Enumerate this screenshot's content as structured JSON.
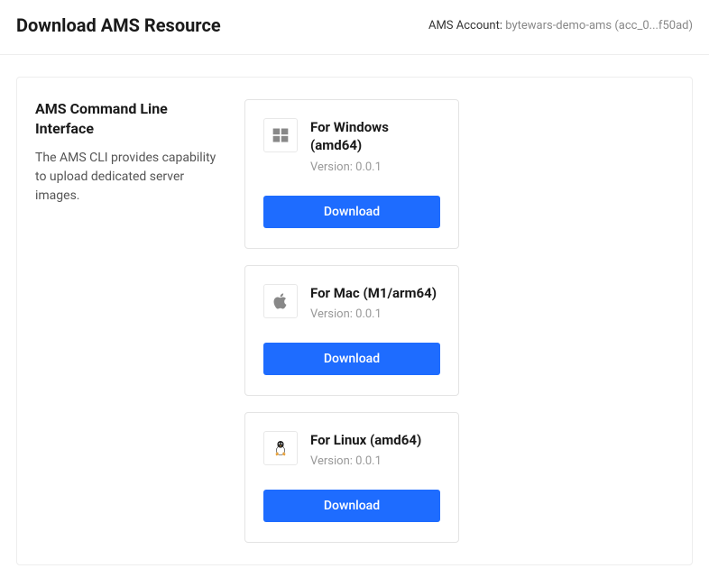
{
  "header": {
    "title": "Download AMS Resource",
    "account_label": "AMS Account:",
    "account_value": "bytewars-demo-ams (acc_0...f50ad)"
  },
  "section": {
    "title": "AMS Command Line Interface",
    "description": "The AMS CLI provides capability to upload dedicated server images."
  },
  "cards": [
    {
      "title": "For Windows (amd64)",
      "version_label": "Version: 0.0.1",
      "button_label": "Download",
      "icon": "windows"
    },
    {
      "title": "For Mac (M1/arm64)",
      "version_label": "Version: 0.0.1",
      "button_label": "Download",
      "icon": "apple"
    },
    {
      "title": "For Linux (amd64)",
      "version_label": "Version: 0.0.1",
      "button_label": "Download",
      "icon": "linux"
    }
  ]
}
